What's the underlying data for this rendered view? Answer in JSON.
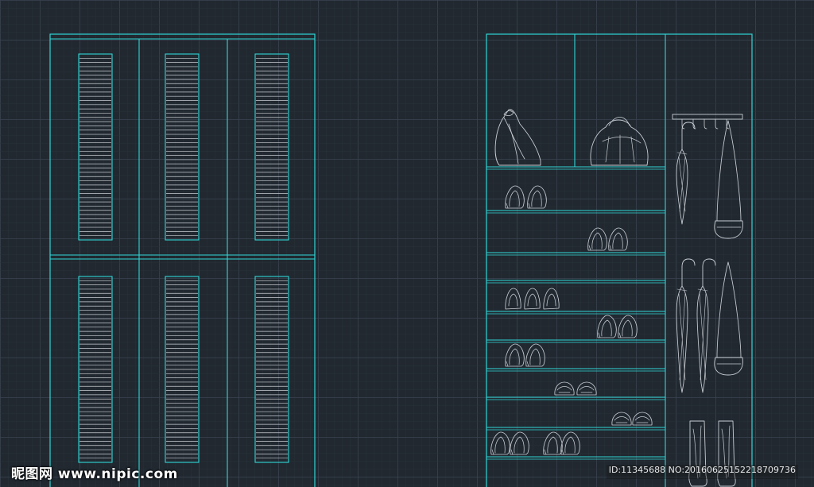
{
  "colors": {
    "background": "#212830",
    "grid_major": "#3a4350",
    "grid_minor": "#2b323b",
    "frame": "#2fd6d6",
    "detail": "#c9ced3"
  },
  "watermark": {
    "site": "昵图网 www.nipic.com",
    "id_text": "ID:11345688 NO:20160625152218709736"
  },
  "drawing": {
    "left_cabinet": {
      "door_columns": 3,
      "door_rows": 2,
      "louver_slats_per_panel": 44
    },
    "right_cabinet": {
      "top_compartments": [
        "bag",
        "bag"
      ],
      "shoe_shelves": [
        [
          "heels",
          "heels"
        ],
        [
          "heels",
          "heels"
        ],
        [],
        [
          "shoes",
          "shoes",
          "shoes"
        ],
        [
          "heels",
          "heels"
        ],
        [
          "heels",
          "heels"
        ],
        [
          "slippers",
          "slippers"
        ],
        [
          "slippers",
          "slippers"
        ],
        [
          "heels",
          "heels",
          "heels",
          "heels"
        ]
      ],
      "side_column_items": [
        "coat-hook-rail",
        "umbrella",
        "handbag",
        "umbrella",
        "umbrella",
        "handbag",
        "boot",
        "boot"
      ]
    }
  }
}
